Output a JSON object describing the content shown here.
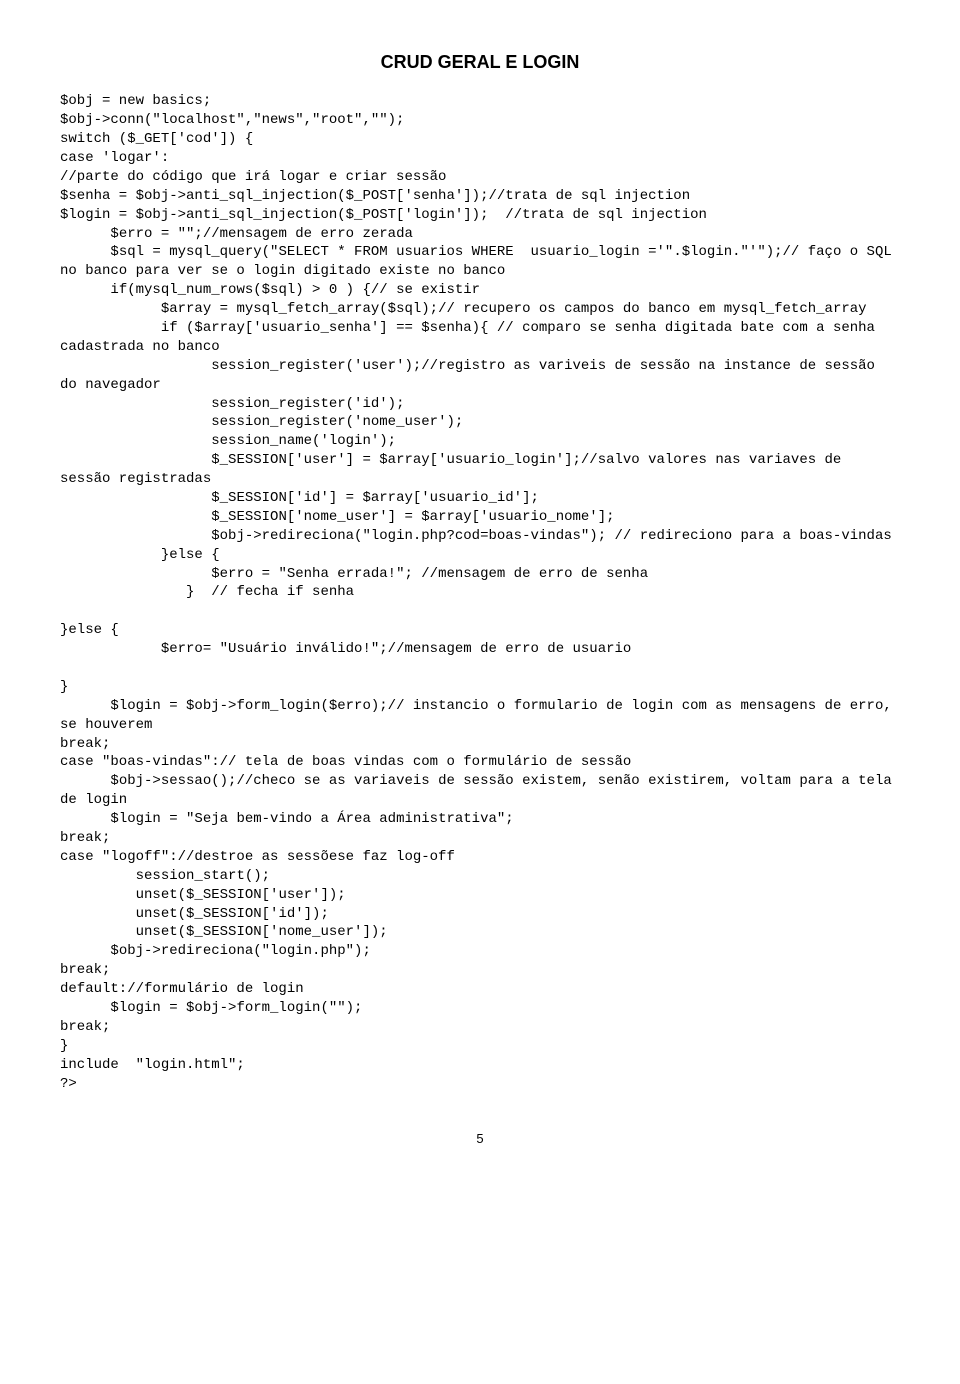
{
  "title": "CRUD GERAL E LOGIN",
  "code": "$obj = new basics;\n$obj->conn(\"localhost\",\"news\",\"root\",\"\");\nswitch ($_GET['cod']) {\ncase 'logar':\n//parte do código que irá logar e criar sessão\n$senha = $obj->anti_sql_injection($_POST['senha']);//trata de sql injection\n$login = $obj->anti_sql_injection($_POST['login']);  //trata de sql injection\n      $erro = \"\";//mensagem de erro zerada\n      $sql = mysql_query(\"SELECT * FROM usuarios WHERE  usuario_login ='\".$login.\"'\");// faço o SQL no banco para ver se o login digitado existe no banco\n      if(mysql_num_rows($sql) > 0 ) {// se existir\n            $array = mysql_fetch_array($sql);// recupero os campos do banco em mysql_fetch_array\n            if ($array['usuario_senha'] == $senha){ // comparo se senha digitada bate com a senha cadastrada no banco\n                  session_register('user');//registro as variveis de sessão na instance de sessão do navegador\n                  session_register('id');\n                  session_register('nome_user');\n                  session_name('login');\n                  $_SESSION['user'] = $array['usuario_login'];//salvo valores nas variaves de sessão registradas\n                  $_SESSION['id'] = $array['usuario_id'];\n                  $_SESSION['nome_user'] = $array['usuario_nome'];\n                  $obj->redireciona(\"login.php?cod=boas-vindas\"); // redireciono para a boas-vindas\n            }else {\n                  $erro = \"Senha errada!\"; //mensagem de erro de senha\n               }  // fecha if senha\n\n}else {\n            $erro= \"Usuário inválido!\";//mensagem de erro de usuario\n\n}\n      $login = $obj->form_login($erro);// instancio o formulario de login com as mensagens de erro, se houverem\nbreak;\ncase \"boas-vindas\":// tela de boas vindas com o formulário de sessão\n      $obj->sessao();//checo se as variaveis de sessão existem, senão existirem, voltam para a tela de login\n      $login = \"Seja bem-vindo a Área administrativa\";\nbreak;\ncase \"logoff\"://destroe as sessõese faz log-off\n         session_start();\n         unset($_SESSION['user']);\n         unset($_SESSION['id']);\n         unset($_SESSION['nome_user']);\n      $obj->redireciona(\"login.php\");\nbreak;\ndefault://formulário de login\n      $login = $obj->form_login(\"\");\nbreak;\n}\ninclude  \"login.html\";\n?>",
  "page_number": "5"
}
